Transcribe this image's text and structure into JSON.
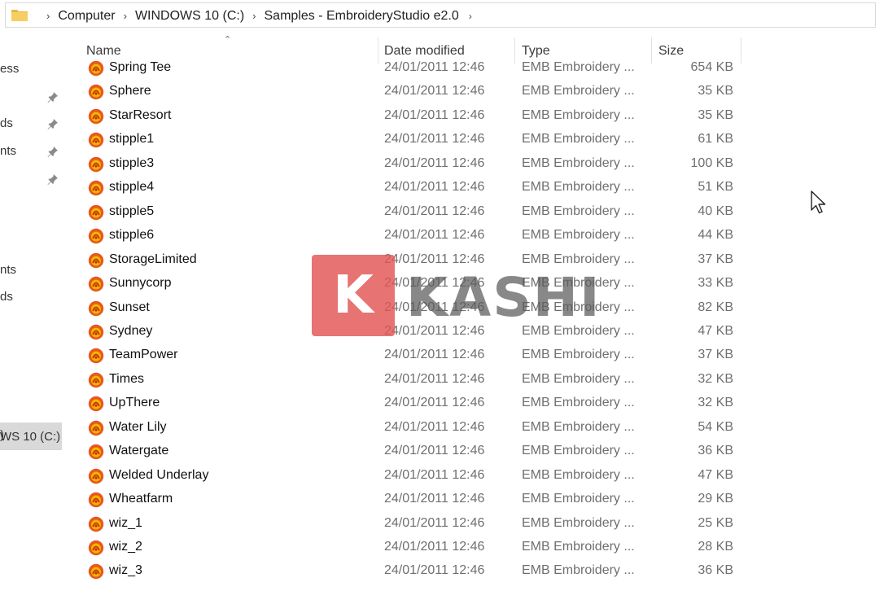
{
  "breadcrumb": [
    "Computer",
    "WINDOWS 10 (C:)",
    "Samples - EmbroideryStudio e2.0"
  ],
  "nav": {
    "labels": [
      "ess",
      "ds",
      "nts",
      "nts",
      "ds",
      "WS 10 (C:)",
      ")"
    ]
  },
  "columns": {
    "name": "Name",
    "date": "Date modified",
    "type": "Type",
    "size": "Size"
  },
  "files": [
    {
      "name": "Spring Tee",
      "date": "24/01/2011 12:46",
      "type": "EMB Embroidery ...",
      "size": "654 KB"
    },
    {
      "name": "Sphere",
      "date": "24/01/2011 12:46",
      "type": "EMB Embroidery ...",
      "size": "35 KB"
    },
    {
      "name": "StarResort",
      "date": "24/01/2011 12:46",
      "type": "EMB Embroidery ...",
      "size": "35 KB"
    },
    {
      "name": "stipple1",
      "date": "24/01/2011 12:46",
      "type": "EMB Embroidery ...",
      "size": "61 KB"
    },
    {
      "name": "stipple3",
      "date": "24/01/2011 12:46",
      "type": "EMB Embroidery ...",
      "size": "100 KB"
    },
    {
      "name": "stipple4",
      "date": "24/01/2011 12:46",
      "type": "EMB Embroidery ...",
      "size": "51 KB"
    },
    {
      "name": "stipple5",
      "date": "24/01/2011 12:46",
      "type": "EMB Embroidery ...",
      "size": "40 KB"
    },
    {
      "name": "stipple6",
      "date": "24/01/2011 12:46",
      "type": "EMB Embroidery ...",
      "size": "44 KB"
    },
    {
      "name": "StorageLimited",
      "date": "24/01/2011 12:46",
      "type": "EMB Embroidery ...",
      "size": "37 KB"
    },
    {
      "name": "Sunnycorp",
      "date": "24/01/2011 12:46",
      "type": "EMB Embroidery ...",
      "size": "33 KB"
    },
    {
      "name": "Sunset",
      "date": "24/01/2011 12:46",
      "type": "EMB Embroidery ...",
      "size": "82 KB"
    },
    {
      "name": "Sydney",
      "date": "24/01/2011 12:46",
      "type": "EMB Embroidery ...",
      "size": "47 KB"
    },
    {
      "name": "TeamPower",
      "date": "24/01/2011 12:46",
      "type": "EMB Embroidery ...",
      "size": "37 KB"
    },
    {
      "name": "Times",
      "date": "24/01/2011 12:46",
      "type": "EMB Embroidery ...",
      "size": "32 KB"
    },
    {
      "name": "UpThere",
      "date": "24/01/2011 12:46",
      "type": "EMB Embroidery ...",
      "size": "32 KB"
    },
    {
      "name": "Water Lily",
      "date": "24/01/2011 12:46",
      "type": "EMB Embroidery ...",
      "size": "54 KB"
    },
    {
      "name": "Watergate",
      "date": "24/01/2011 12:46",
      "type": "EMB Embroidery ...",
      "size": "36 KB"
    },
    {
      "name": "Welded Underlay",
      "date": "24/01/2011 12:46",
      "type": "EMB Embroidery ...",
      "size": "47 KB"
    },
    {
      "name": "Wheatfarm",
      "date": "24/01/2011 12:46",
      "type": "EMB Embroidery ...",
      "size": "29 KB"
    },
    {
      "name": "wiz_1",
      "date": "24/01/2011 12:46",
      "type": "EMB Embroidery ...",
      "size": "25 KB"
    },
    {
      "name": "wiz_2",
      "date": "24/01/2011 12:46",
      "type": "EMB Embroidery ...",
      "size": "28 KB"
    },
    {
      "name": "wiz_3",
      "date": "24/01/2011 12:46",
      "type": "EMB Embroidery ...",
      "size": "36 KB"
    }
  ],
  "watermark": {
    "letter": "K",
    "text": "KASHI"
  },
  "icons": {
    "folder": "folder-icon",
    "file": "emb-file-icon",
    "pin": "pin-icon",
    "cursor": "mouse-cursor-icon"
  },
  "colors": {
    "selected_nav": "#d9d9d9",
    "emb_icon_outer": "#e8581c",
    "emb_icon_inner": "#f5b400",
    "watermark_red": "#e25454"
  }
}
